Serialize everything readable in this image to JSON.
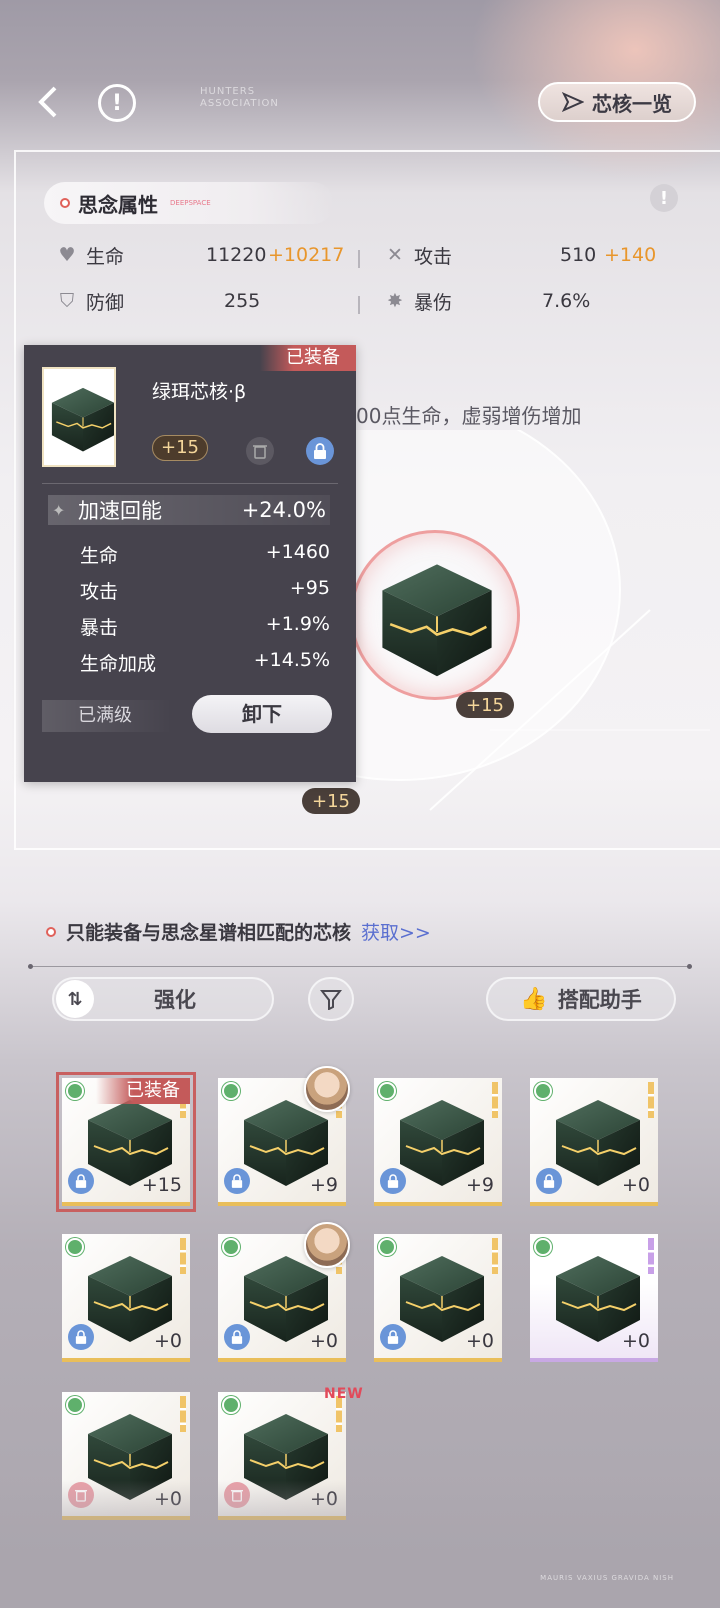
{
  "header": {
    "hunters_text": "HUNTERS\nASSOCIATION",
    "core_list_label": "芯核一览"
  },
  "attributes": {
    "title": "思念属性",
    "sub": "DEEPSPACE",
    "stats": [
      {
        "name": "生命",
        "value": "11220",
        "bonus": "+10217",
        "icon": "heart-icon"
      },
      {
        "name": "攻击",
        "value": "510",
        "bonus": "+140",
        "icon": "swords-icon"
      },
      {
        "name": "防御",
        "value": "255",
        "bonus": "",
        "icon": "shield-icon"
      },
      {
        "name": "暴伤",
        "value": "7.6%",
        "bonus": "",
        "icon": "burst-icon"
      }
    ],
    "talent_fragment": "00点生命，虚弱增伤增加"
  },
  "arena": {
    "center_level": "+15",
    "bottom_level": "+15"
  },
  "popup": {
    "equipped_tag": "已装备",
    "core_name": "绿珥芯核·β",
    "level": "+15",
    "main_stat": {
      "label": "加速回能",
      "value": "+24.0%"
    },
    "sub_stats": [
      {
        "label": "生命",
        "value": "+1460"
      },
      {
        "label": "攻击",
        "value": "+95"
      },
      {
        "label": "暴击",
        "value": "+1.9%"
      },
      {
        "label": "生命加成",
        "value": "+14.5%"
      }
    ],
    "maxed_label": "已满级",
    "unequip_label": "卸下"
  },
  "inventory": {
    "tip": "只能装备与思念星谱相匹配的芯核",
    "get_link": "获取>>",
    "enhance_label": "强化",
    "helper_label": "搭配助手",
    "equipped_tag": "已装备",
    "new_tag": "NEW",
    "items": [
      {
        "level": "+15"
      },
      {
        "level": "+9"
      },
      {
        "level": "+9"
      },
      {
        "level": "+0"
      },
      {
        "level": "+0"
      },
      {
        "level": "+0"
      },
      {
        "level": "+0"
      },
      {
        "level": "+0"
      },
      {
        "level": "+0"
      },
      {
        "level": "+0"
      }
    ]
  },
  "footer": {
    "text": "MAURIS VAXIUS GRAVIDA NISH"
  },
  "colors": {
    "accent_orange": "#e8962c",
    "equipped_red": "#c45a5a",
    "lock_blue": "#6a95d8",
    "panel_dark": "#46434d"
  }
}
